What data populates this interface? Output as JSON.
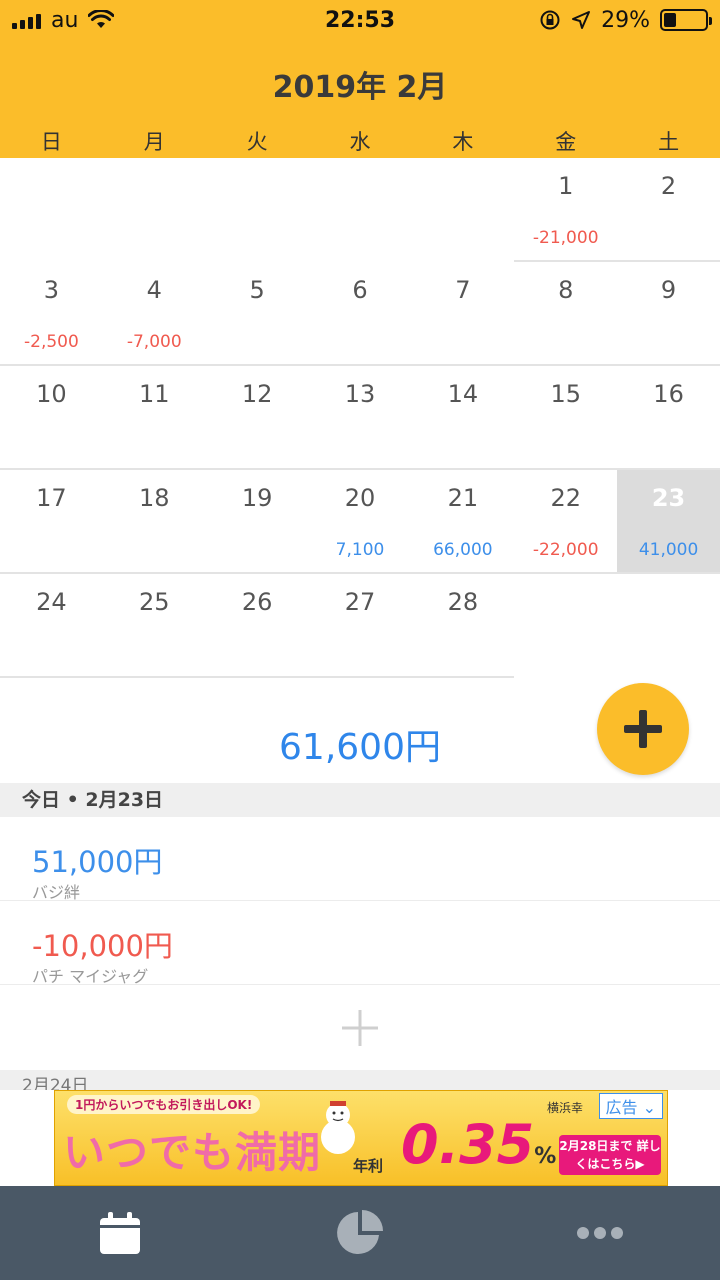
{
  "status": {
    "carrier": "au",
    "time": "22:53",
    "battery": "29%"
  },
  "header": {
    "month_title": "2019年 2月"
  },
  "weekdays": [
    "日",
    "月",
    "火",
    "水",
    "木",
    "金",
    "土"
  ],
  "calendar": {
    "days": [
      {
        "day": "1",
        "amount": "-21,000",
        "kind": "neg"
      },
      {
        "day": "2",
        "amount": "",
        "kind": ""
      },
      {
        "day": "3",
        "amount": "-2,500",
        "kind": "neg"
      },
      {
        "day": "4",
        "amount": "-7,000",
        "kind": "neg"
      },
      {
        "day": "5",
        "amount": "",
        "kind": ""
      },
      {
        "day": "6",
        "amount": "",
        "kind": ""
      },
      {
        "day": "7",
        "amount": "",
        "kind": ""
      },
      {
        "day": "8",
        "amount": "",
        "kind": ""
      },
      {
        "day": "9",
        "amount": "",
        "kind": ""
      },
      {
        "day": "10",
        "amount": "",
        "kind": ""
      },
      {
        "day": "11",
        "amount": "",
        "kind": ""
      },
      {
        "day": "12",
        "amount": "",
        "kind": ""
      },
      {
        "day": "13",
        "amount": "",
        "kind": ""
      },
      {
        "day": "14",
        "amount": "",
        "kind": ""
      },
      {
        "day": "15",
        "amount": "",
        "kind": ""
      },
      {
        "day": "16",
        "amount": "",
        "kind": ""
      },
      {
        "day": "17",
        "amount": "",
        "kind": ""
      },
      {
        "day": "18",
        "amount": "",
        "kind": ""
      },
      {
        "day": "19",
        "amount": "",
        "kind": ""
      },
      {
        "day": "20",
        "amount": "7,100",
        "kind": "pos"
      },
      {
        "day": "21",
        "amount": "66,000",
        "kind": "pos"
      },
      {
        "day": "22",
        "amount": "-22,000",
        "kind": "neg"
      },
      {
        "day": "23",
        "amount": "41,000",
        "kind": "pos",
        "today": true
      },
      {
        "day": "24",
        "amount": "",
        "kind": ""
      },
      {
        "day": "25",
        "amount": "",
        "kind": ""
      },
      {
        "day": "26",
        "amount": "",
        "kind": ""
      },
      {
        "day": "27",
        "amount": "",
        "kind": ""
      },
      {
        "day": "28",
        "amount": "",
        "kind": ""
      }
    ]
  },
  "summary": {
    "total": "61,600円"
  },
  "today_section": {
    "header": "今日 • 2月23日",
    "entries": [
      {
        "amount": "51,000円",
        "note": "バジ絆",
        "kind": "pos"
      },
      {
        "amount": "-10,000円",
        "note": "パチ マイジャグ",
        "kind": "neg"
      }
    ]
  },
  "next_section": {
    "header": "2月24日"
  },
  "ad": {
    "subtitle": "1円からいつでもお引き出しOK!",
    "headline": "いつでも満期",
    "rate_label": "年利",
    "rate": "0.35",
    "percent": "%",
    "cta": "2月28日まで 詳しくはこちら▶",
    "badge": "広告 ⌄",
    "brand": "横浜幸"
  },
  "colors": {
    "accent": "#fbbd2a",
    "positive": "#3d8fea",
    "negative": "#f05a4f",
    "tabbar": "#4a5866"
  }
}
